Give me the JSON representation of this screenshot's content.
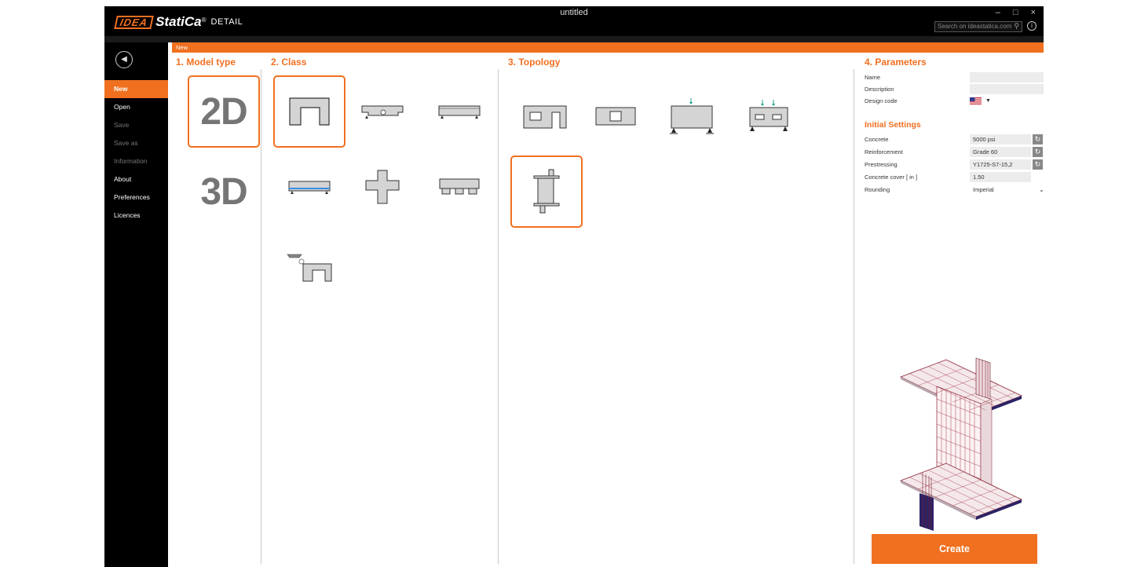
{
  "window": {
    "title": "untitled",
    "app_product": "DETAIL",
    "controls": [
      "–",
      "□",
      "×"
    ],
    "search_placeholder": "Search on ideastatica.com"
  },
  "logo": {
    "idea": "IDEA",
    "statica": "StatiCa",
    "reg": "®"
  },
  "breadcrumb": "New",
  "sidebar": {
    "items": [
      {
        "label": "New",
        "state": "active"
      },
      {
        "label": "Open",
        "state": "enabled"
      },
      {
        "label": "Save",
        "state": "disabled"
      },
      {
        "label": "Save as",
        "state": "disabled"
      },
      {
        "label": "Information",
        "state": "disabled"
      },
      {
        "label": "About",
        "state": "enabled"
      },
      {
        "label": "Preferences",
        "state": "enabled"
      },
      {
        "label": "Licences",
        "state": "enabled"
      }
    ]
  },
  "sections": {
    "model_type": "1. Model type",
    "class": "2. Class",
    "topology": "3. Topology",
    "parameters": "4. Parameters"
  },
  "model_types": [
    {
      "label": "2D",
      "selected": true
    },
    {
      "label": "3D",
      "selected": false
    }
  ],
  "class_icons": [
    {
      "name": "opening-wall",
      "selected": true
    },
    {
      "name": "dapped-end-beam",
      "selected": false
    },
    {
      "name": "simple-beam",
      "selected": false
    },
    {
      "name": "prestressed-beam",
      "selected": false
    },
    {
      "name": "frame-joint",
      "selected": false
    },
    {
      "name": "pile-cap",
      "selected": false
    },
    {
      "name": "corbel-wall",
      "selected": false
    }
  ],
  "topology_icons": [
    {
      "name": "wall-with-opening-and-door",
      "selected": false
    },
    {
      "name": "wall-with-opening",
      "selected": false
    },
    {
      "name": "deep-beam",
      "selected": false
    },
    {
      "name": "deep-beam-with-openings",
      "selected": false
    },
    {
      "name": "wall-with-slabs",
      "selected": true
    }
  ],
  "parameters": {
    "name_label": "Name",
    "name_value": "",
    "description_label": "Description",
    "description_value": "",
    "design_code_label": "Design code",
    "design_code_flag": "us-flag-icon",
    "initial_settings": "Initial Settings",
    "concrete_label": "Concrete",
    "concrete_value": "5000 psi",
    "reinforcement_label": "Reinforcement",
    "reinforcement_value": "Grade 60",
    "prestressing_label": "Prestressing",
    "prestressing_value": "Y1725-S7-15,2",
    "cover_label": "Concrete cover  [ in ]",
    "cover_value": "1.50",
    "rounding_label": "Rounding",
    "rounding_value": "Imperial"
  },
  "create_label": "Create",
  "colors": {
    "accent": "#f07020",
    "sidebar": "#000000",
    "icon_fill": "#d4d4d4"
  }
}
